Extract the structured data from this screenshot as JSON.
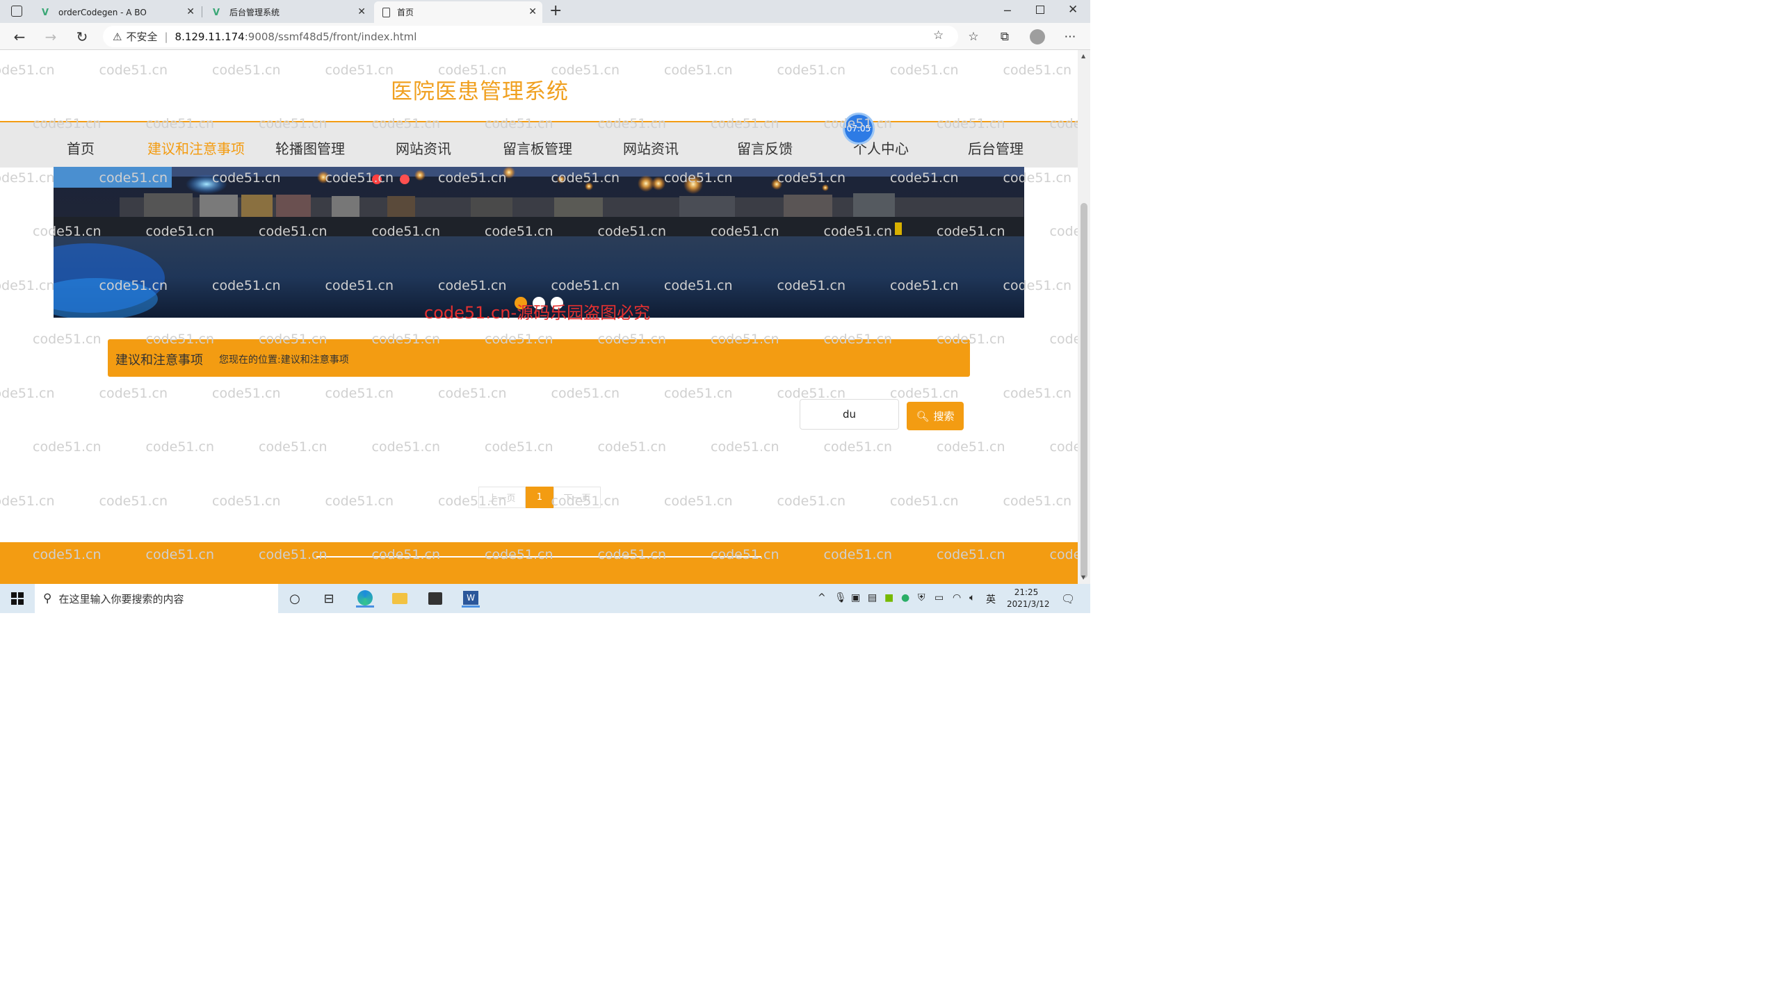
{
  "browser": {
    "tabs": [
      {
        "title": "orderCodegen - A BO",
        "active": false
      },
      {
        "title": "后台管理系统",
        "active": false
      },
      {
        "title": "首页",
        "active": true
      }
    ],
    "new_tab_symbol": "+",
    "security_label": "不安全",
    "url_host": "8.129.11.174",
    "url_path": ":9008/ssmf48d5/front/index.html",
    "window_controls": [
      "minimize-icon",
      "restore-icon",
      "close-icon"
    ]
  },
  "site": {
    "title": "医院医患管理系统",
    "nav": [
      {
        "label": "首页",
        "active": false
      },
      {
        "label": "建议和注意事项",
        "active": true
      },
      {
        "label": "轮播图管理",
        "active": false
      },
      {
        "label": "网站资讯",
        "active": false
      },
      {
        "label": "留言板管理",
        "active": false
      },
      {
        "label": "网站资讯",
        "active": false
      },
      {
        "label": "留言反馈",
        "active": false
      },
      {
        "label": "个人中心",
        "active": false
      },
      {
        "label": "后台管理",
        "active": false
      }
    ],
    "clock_badge": "07:05",
    "carousel": {
      "slide_count": 3,
      "active_index": 0
    },
    "breadcrumb": {
      "title": "建议和注意事项",
      "position_label": "您现在的位置:",
      "position_value": "建议和注意事项"
    },
    "search": {
      "value": "du",
      "button_label": "搜索"
    },
    "pagination": {
      "prev": "上一页",
      "current": "1",
      "next": "下一页"
    },
    "watermark_text": "code51.cn",
    "red_watermark": "code51.cn-源码乐园盗图必究"
  },
  "colors": {
    "accent": "#f39c12",
    "title_orange": "#f0a020",
    "menu_bg": "#e8e8e8",
    "footer": "#f39c12"
  },
  "taskbar": {
    "search_placeholder": "在这里输入你要搜索的内容",
    "ime_label": "英",
    "time": "21:25",
    "date": "2021/3/12"
  }
}
